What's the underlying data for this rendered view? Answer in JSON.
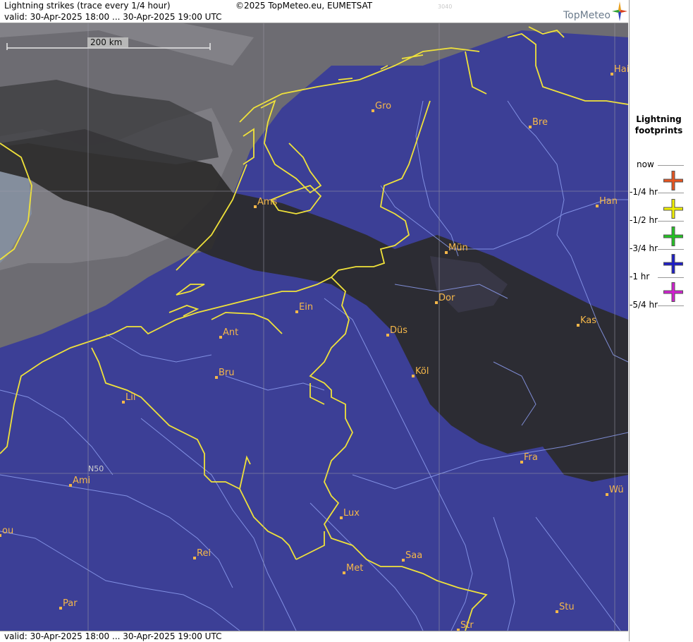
{
  "header": {
    "title": "Lightning strikes (trace every 1/4 hour)",
    "copyright": "©2025 TopMeteo.eu, EUMETSAT",
    "code": "3040",
    "valid": "valid:  30-Apr-2025 18:00 ... 30-Apr-2025 19:00 UTC",
    "logo_text": "TopMeteo"
  },
  "footer": {
    "valid": "valid:  30-Apr-2025 18:00 ... 30-Apr-2025 19:00 UTC"
  },
  "map": {
    "scale_label": "200 km",
    "grid_label": "N50",
    "cities": [
      {
        "name": "Gro"
      },
      {
        "name": "Ams"
      },
      {
        "name": "Bre"
      },
      {
        "name": "Han"
      },
      {
        "name": "Hai"
      },
      {
        "name": "Mün"
      },
      {
        "name": "Ein"
      },
      {
        "name": "Dor"
      },
      {
        "name": "Ant"
      },
      {
        "name": "Düs"
      },
      {
        "name": "Kas"
      },
      {
        "name": "Bru"
      },
      {
        "name": "Köl"
      },
      {
        "name": "Lil"
      },
      {
        "name": "Fra"
      },
      {
        "name": "Ami"
      },
      {
        "name": "Wü"
      },
      {
        "name": "Lux"
      },
      {
        "name": "ou"
      },
      {
        "name": "Rei"
      },
      {
        "name": "Saa"
      },
      {
        "name": "Met"
      },
      {
        "name": "Par"
      },
      {
        "name": "Stu"
      },
      {
        "name": "Str"
      }
    ]
  },
  "legend": {
    "title": "Lightning footprints",
    "items": [
      {
        "label": "now",
        "color": "#e8541e"
      },
      {
        "label": "-1/4 hr",
        "color": "#f0f000"
      },
      {
        "label": "-1/2 hr",
        "color": "#22c322"
      },
      {
        "label": "-3/4 hr",
        "color": "#1c1cc8"
      },
      {
        "label": "-1 hr",
        "color": "#d21ed2"
      },
      {
        "label": "-5/4 hr",
        "color": null
      }
    ]
  },
  "colors": {
    "land": "#3c3f96",
    "cloud": "#2b2a2a",
    "border": "#f0e23a",
    "river": "#8d9df0",
    "city": "#f5b74a"
  }
}
